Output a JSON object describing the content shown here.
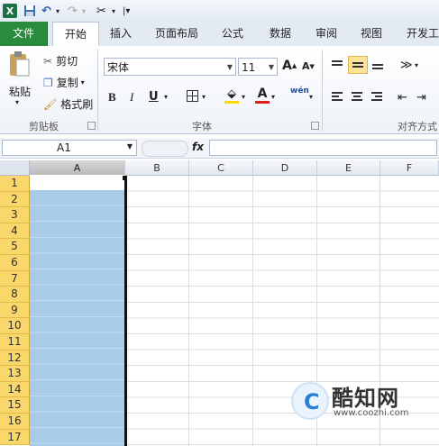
{
  "quick_access": {
    "logo": "X"
  },
  "tabs": [
    "文件",
    "开始",
    "插入",
    "页面布局",
    "公式",
    "数据",
    "审阅",
    "视图",
    "开发工"
  ],
  "clipboard": {
    "paste": "粘贴",
    "cut": "剪切",
    "copy": "复制",
    "format_painter": "格式刷",
    "group": "剪贴板"
  },
  "font": {
    "name": "宋体",
    "size": "11",
    "bold": "B",
    "italic": "I",
    "underline": "U",
    "color_letter": "A",
    "grow": "A",
    "shrink": "A",
    "phonetic": "wén",
    "group": "字体"
  },
  "alignment": {
    "group": "对齐方式"
  },
  "formula_bar": {
    "name_box": "A1",
    "fx": "fx",
    "value": ""
  },
  "grid": {
    "columns": [
      "A",
      "B",
      "C",
      "D",
      "E",
      "F"
    ],
    "rows": [
      "1",
      "2",
      "3",
      "4",
      "5",
      "6",
      "7",
      "8",
      "9",
      "10",
      "11",
      "12",
      "13",
      "14",
      "15",
      "16",
      "17"
    ],
    "selected_column": "A",
    "active_cell": "A1",
    "selection_color": "#a8cbea",
    "row_header_color": "#f9d76b"
  },
  "watermark": {
    "logo_letter": "C",
    "title": "酷知网",
    "url": "www.coozhi.com"
  },
  "colors": {
    "file_tab": "#2a8a3d",
    "font_color_bar": "#e02020",
    "fill_bar": "#ffd800"
  }
}
